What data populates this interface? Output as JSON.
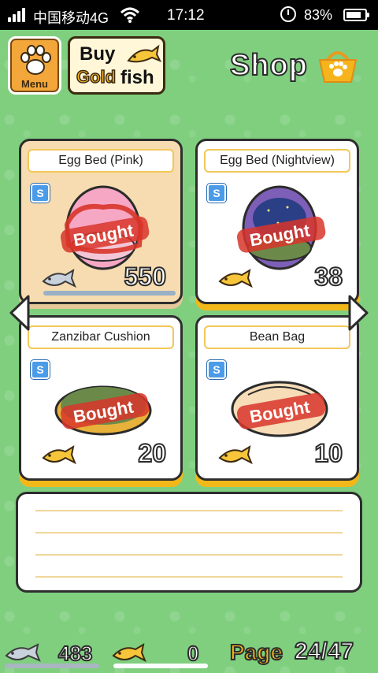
{
  "status_bar": {
    "carrier": "中国移动4G",
    "time": "17:12",
    "battery_percent": "83%",
    "battery_level": 0.83,
    "icons": [
      "signal-icon",
      "wifi-icon",
      "alarm-icon",
      "battery-icon"
    ]
  },
  "header": {
    "menu_label": "Menu",
    "buy_label": "Buy",
    "gold_label": "Gold",
    "fish_label": "fish",
    "shop_title": "Shop"
  },
  "items": [
    {
      "name": "Egg Bed (Pink)",
      "badge": "S",
      "status": "Bought",
      "price": "550",
      "currency": "silver",
      "selected": true
    },
    {
      "name": "Egg Bed (Nightview)",
      "badge": "S",
      "status": "Bought",
      "price": "38",
      "currency": "gold",
      "selected": false
    },
    {
      "name": "Zanzibar Cushion",
      "badge": "S",
      "status": "Bought",
      "price": "20",
      "currency": "gold",
      "selected": false
    },
    {
      "name": "Bean Bag",
      "badge": "S",
      "status": "Bought",
      "price": "10",
      "currency": "gold",
      "selected": false
    }
  ],
  "footer": {
    "silver_fish": "483",
    "gold_fish": "0",
    "page_label": "Page",
    "page_number": "24/47"
  },
  "colors": {
    "background": "#7fcf7f",
    "gold": "#f6b41c",
    "stamp_red": "#d8352a",
    "badge_blue": "#4a9be8"
  }
}
